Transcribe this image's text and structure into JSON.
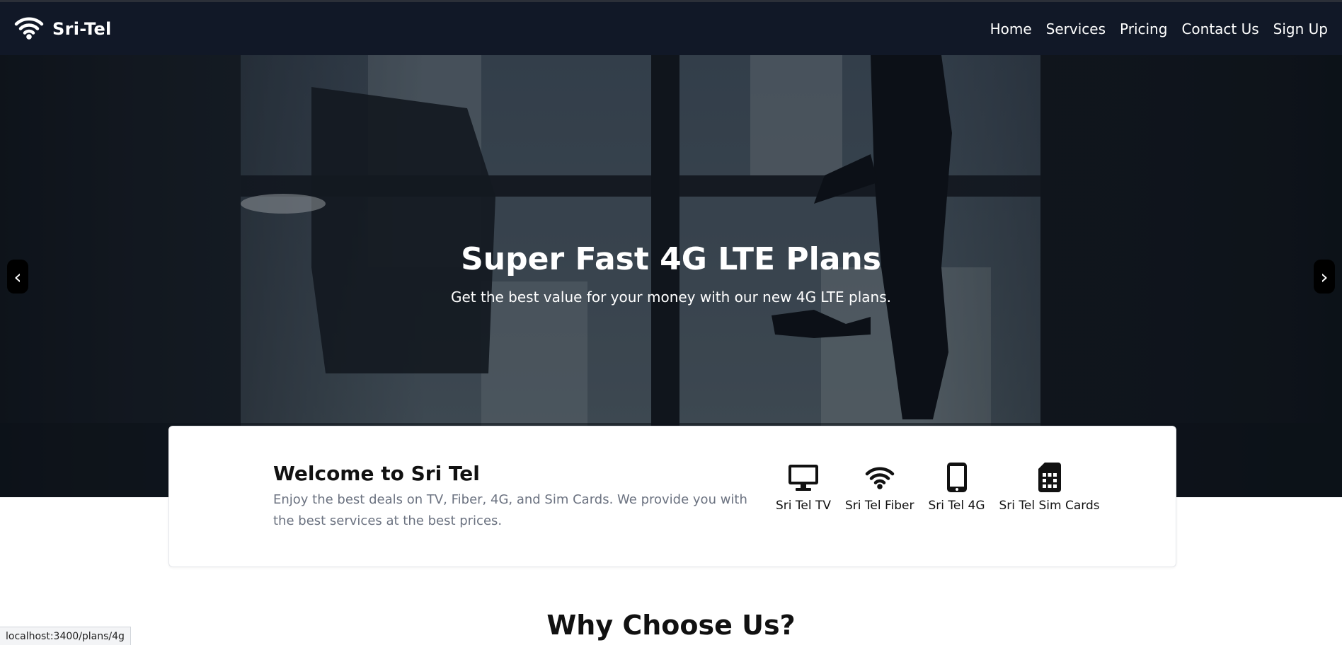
{
  "brand": {
    "name": "Sri-Tel",
    "icon": "wifi-icon"
  },
  "nav": {
    "links": [
      "Home",
      "Services",
      "Pricing",
      "Contact Us",
      "Sign Up"
    ]
  },
  "hero": {
    "title": "Super Fast 4G LTE Plans",
    "subtitle": "Get the best value for your money with our new 4G LTE plans.",
    "prev_label": "‹",
    "next_label": "›"
  },
  "welcome": {
    "title": "Welcome to Sri Tel",
    "description": "Enjoy the best deals on TV, Fiber, 4G, and Sim Cards. We provide you with the best services at the best prices.",
    "services": [
      {
        "label": "Sri Tel TV",
        "icon": "monitor-icon"
      },
      {
        "label": "Sri Tel Fiber",
        "icon": "wifi-icon"
      },
      {
        "label": "Sri Tel 4G",
        "icon": "mobile-phone-icon"
      },
      {
        "label": "Sri Tel Sim Cards",
        "icon": "sim-card-icon"
      }
    ]
  },
  "why": {
    "title": "Why Choose Us?"
  },
  "status_bar": {
    "url": "localhost:3400/plans/4g"
  },
  "colors": {
    "navbar": "#111827",
    "text_muted": "#6b7280"
  }
}
